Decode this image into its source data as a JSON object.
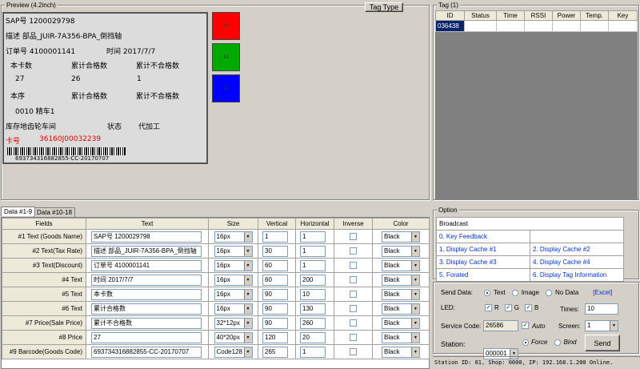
{
  "preview": {
    "group_label": "Preview (4.2inch)",
    "tag_type_button": "Tag Type",
    "lines": [
      "SAP号 1200029798",
      "描述   部品_JUIR-7A356-BPA_倒挡轴",
      "订单号 4100001141",
      "时间 2017/7/7",
      "本卡数",
      "累计合格数",
      "累计不合格数",
      "27",
      "26",
      "1",
      "本序",
      "累计合格数",
      "累计不合格数",
      "0010 精车1",
      "库存地齿轮车间",
      "状态",
      "代加工",
      "卡号",
      "36160J00032239",
      "693734316882855-CC-20170707"
    ],
    "swatches": [
      {
        "label": "10",
        "color": "#ff0000"
      },
      {
        "label": "10",
        "color": "#00aa00"
      },
      {
        "label": "10",
        "color": "#0000ff"
      }
    ]
  },
  "tag": {
    "group_label": "Tag (1)",
    "columns": [
      "ID",
      "Status",
      "Time",
      "RSSI",
      "Power",
      "Temp.",
      "Key"
    ],
    "rows": [
      [
        "036438",
        "",
        "",
        "",
        "",
        "",
        ""
      ]
    ]
  },
  "tabs": [
    "Data #1-9",
    "Data #10-18"
  ],
  "grid": {
    "headers": [
      "Fields",
      "Text",
      "Size",
      "Vertical",
      "Horizontal",
      "Inverse",
      "Color"
    ],
    "rows": [
      {
        "field": "#1 Text (Goods Name)",
        "text": "SAP号 1200029798",
        "size": "16px",
        "vertical": "1",
        "horizontal": "1",
        "color": "Black"
      },
      {
        "field": "#2 Text(Tax Rate)",
        "text": "描述   部品_JUIR-7A356-BPA_倒挡轴",
        "size": "16px",
        "vertical": "30",
        "horizontal": "1",
        "color": "Black"
      },
      {
        "field": "#3 Text(Discount)",
        "text": "订单号 4100001141",
        "size": "16px",
        "vertical": "60",
        "horizontal": "1",
        "color": "Black"
      },
      {
        "field": "#4 Text",
        "text": "时间 2017/7/7",
        "size": "16px",
        "vertical": "60",
        "horizontal": "200",
        "color": "Black"
      },
      {
        "field": "#5 Text",
        "text": "本卡数",
        "size": "16px",
        "vertical": "90",
        "horizontal": "10",
        "color": "Black"
      },
      {
        "field": "#6 Text",
        "text": "累计合格数",
        "size": "16px",
        "vertical": "90",
        "horizontal": "130",
        "color": "Black"
      },
      {
        "field": "#7 Price(Sale Price)",
        "text": "累计不合格数",
        "size": "32*12px",
        "vertical": "90",
        "horizontal": "260",
        "color": "Black"
      },
      {
        "field": "#8 Price",
        "text": "27",
        "size": "40*20px",
        "vertical": "120",
        "horizontal": "20",
        "color": "Black"
      },
      {
        "field": "#9 Barcode(Goods Code)",
        "text": "693734316882855-CC-20170707",
        "size": "Code128",
        "vertical": "265",
        "horizontal": "1",
        "color": "Black"
      }
    ]
  },
  "option": {
    "group_label": "Option",
    "broadcast_label": "Broadcast",
    "items": [
      "0. Key Feedback",
      "",
      "1. Display Cache #1",
      "2. Display Cache #2",
      "3. Display Cache #3",
      "4. Display Cache #4",
      "5. Forated",
      "6. Display Tag Information"
    ]
  },
  "controls": {
    "send_data_label": "Send Data:",
    "send_options": [
      "Text",
      "Image",
      "No Data"
    ],
    "excel_link": "[Excel]",
    "led_label": "LED:",
    "led_options": [
      "R",
      "G",
      "B"
    ],
    "times_label": "Times:",
    "times_value": "10",
    "service_code_label": "Service Code:",
    "service_code_value": "26586",
    "auto_label": "Auto",
    "screen_label": "Screen:",
    "screen_value": "1",
    "station_label": "Station:",
    "station_value": "000001",
    "force_label": "Force",
    "bind_label": "Bind",
    "send_button": "Send"
  },
  "status": "Station ID: 01, Shop: 0000, IP: 192.168.1.200 Online."
}
